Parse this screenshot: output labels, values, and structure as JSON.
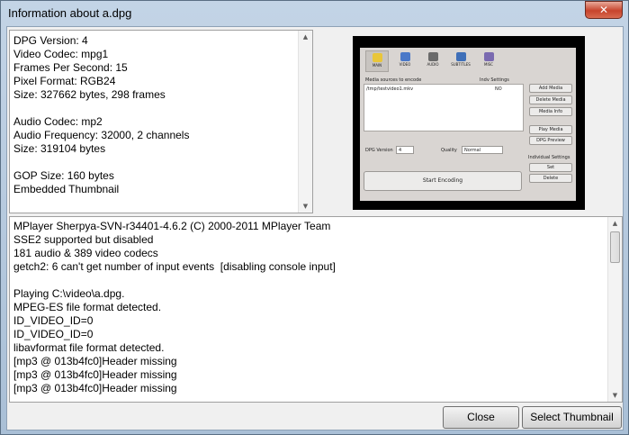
{
  "window": {
    "title": "Information about a.dpg",
    "close_glyph": "✕"
  },
  "info": {
    "lines": [
      "DPG Version: 4",
      "Video Codec: mpg1",
      "Frames Per Second: 15",
      "Pixel Format: RGB24",
      "Size: 327662 bytes, 298 frames",
      "",
      "Audio Codec: mp2",
      "Audio Frequency: 32000, 2 channels",
      "Size: 319104 bytes",
      "",
      "GOP Size: 160 bytes",
      "Embedded Thumbnail"
    ]
  },
  "thumbnail": {
    "tabs": [
      {
        "label": "MAIN",
        "icon": "star-icon",
        "color": "#e9c63a"
      },
      {
        "label": "VIDEO",
        "icon": "monitor-icon",
        "color": "#4a78c8"
      },
      {
        "label": "AUDIO",
        "icon": "speaker-icon",
        "color": "#6a6a6a"
      },
      {
        "label": "SUBTITLES",
        "icon": "subtitles-icon",
        "color": "#3f6fb8"
      },
      {
        "label": "MISC",
        "icon": "misc-icon",
        "color": "#7a6ab0"
      }
    ],
    "media_label": "Media sources to encode",
    "indv_label": "Indv Settings",
    "list_item": "/tmp/testvideo1.mkv",
    "list_item_setting": "NO",
    "buttons": [
      "Add Media",
      "Delete Media",
      "Media Info",
      "Play Media",
      "DPG Preview",
      "Set",
      "Delete"
    ],
    "dpg_version_label": "DPG Version",
    "dpg_version_value": "4",
    "quality_label": "Quality",
    "quality_value": "Normal",
    "individual_settings": "Individual Settings",
    "start_encoding": "Start Encoding"
  },
  "log": {
    "lines": [
      "MPlayer Sherpya-SVN-r34401-4.6.2 (C) 2000-2011 MPlayer Team",
      "SSE2 supported but disabled",
      "181 audio & 389 video codecs",
      "getch2: 6 can't get number of input events  [disabling console input]",
      "",
      "Playing C:\\video\\a.dpg.",
      "MPEG-ES file format detected.",
      "ID_VIDEO_ID=0",
      "ID_VIDEO_ID=0",
      "libavformat file format detected.",
      "[mp3 @ 013b4fc0]Header missing",
      "[mp3 @ 013b4fc0]Header missing",
      "[mp3 @ 013b4fc0]Header missing"
    ]
  },
  "buttons": {
    "close": "Close",
    "select_thumbnail": "Select Thumbnail"
  }
}
